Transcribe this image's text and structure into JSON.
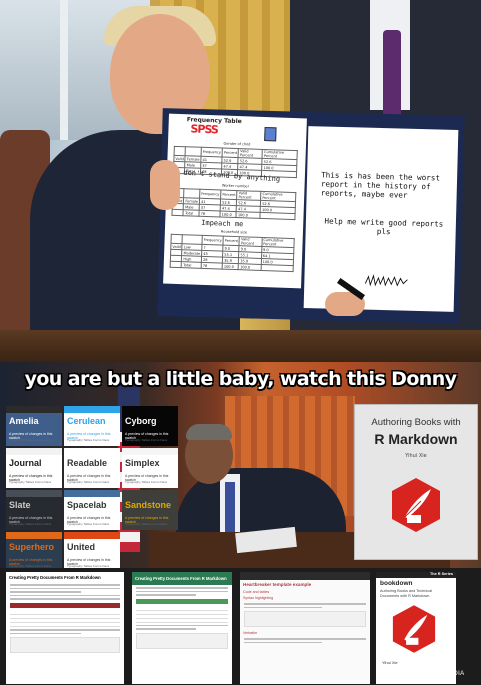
{
  "top_panel": {
    "folder_left": {
      "table_title": "Frequency Table",
      "logo": "SPSS",
      "first_table_caption": "Gender of child",
      "handwritten_line_1": "I don't stand by anything",
      "second_table_caption": "Worker number",
      "handwritten_line_2": "Impeach me",
      "third_table_caption": "Household size",
      "table_rows": [
        [
          "",
          "",
          "Frequency",
          "Percent",
          "Valid Percent",
          "Cumulative Percent"
        ],
        [
          "Valid",
          "Female",
          "41",
          "52.6",
          "52.6",
          "52.6"
        ],
        [
          "",
          "Male",
          "37",
          "47.4",
          "47.4",
          "100.0"
        ],
        [
          "",
          "Total",
          "78",
          "100.0",
          "100.0",
          ""
        ]
      ],
      "third_table_rows": [
        [
          "",
          "",
          "Frequency",
          "Percent",
          "Valid Percent",
          "Cumulative Percent"
        ],
        [
          "Valid",
          "Low",
          "7",
          "9.0",
          "9.0",
          "9.0"
        ],
        [
          "",
          "Moderate",
          "43",
          "55.1",
          "55.1",
          "64.1"
        ],
        [
          "",
          "High",
          "28",
          "35.9",
          "35.9",
          "100.0"
        ],
        [
          "",
          "Total",
          "78",
          "100.0",
          "100.0",
          ""
        ]
      ]
    },
    "folder_right": {
      "note_1": "This is has been the worst report in the history of reports, maybe ever",
      "note_2": "Help me write good reports pls"
    }
  },
  "middle_panel": {
    "caption": "you are but a little baby, watch this Donny",
    "themes": [
      {
        "name": "Amelia",
        "bar": "#2b2b2b",
        "bg": "#3f5f8a",
        "fg": "#ffffff"
      },
      {
        "name": "Cerulean",
        "bar": "#2fa4e7",
        "bg": "#ffffff",
        "fg": "#2fa4e7"
      },
      {
        "name": "Cyborg",
        "bar": "#060606",
        "bg": "#060606",
        "fg": "#ffffff"
      },
      {
        "name": "Journal",
        "bar": "#f2f2f2",
        "bg": "#ffffff",
        "fg": "#222222"
      },
      {
        "name": "Readable",
        "bar": "#ffffff",
        "bg": "#ffffff",
        "fg": "#333333"
      },
      {
        "name": "Simplex",
        "bar": "#f5f5f5",
        "bg": "#ffffff",
        "fg": "#333333"
      },
      {
        "name": "Slate",
        "bar": "#484e55",
        "bg": "#272b30",
        "fg": "#c8c8c8"
      },
      {
        "name": "Spacelab",
        "bar": "#446e9b",
        "bg": "#ffffff",
        "fg": "#333333"
      },
      {
        "name": "Sandstone",
        "bar": "#3e3f3a",
        "bg": "#3e3f3a",
        "fg": "#e0a800"
      },
      {
        "name": "Superhero",
        "bar": "#df691a",
        "bg": "#2b3e50",
        "fg": "#df691a"
      },
      {
        "name": "United",
        "bar": "#dd4814",
        "bg": "#ffffff",
        "fg": "#333333"
      }
    ],
    "theme_subtitle": "A preview of changes in this swatch",
    "theme_links": "Typography Tables Forms Navs",
    "book": {
      "title_line_1": "Authoring Books with",
      "title_line_2": "R Markdown",
      "author": "Yihui Xie",
      "hex_color": "#d8241f"
    }
  },
  "bottom_panel": {
    "doc_1_title": "Creating Pretty Documents From R Markdown",
    "doc_2_title": "Creating Pretty Documents From R Markdown",
    "doc_3_title": "Heartbreaker template example",
    "doc_3_section_1": "Code and tables",
    "doc_3_section_2": "Syntax highlighting",
    "doc_3_section_3": "Verbatim",
    "book": {
      "series": "The R Series",
      "title": "bookdown",
      "subtitle": "Authoring Books and Technical Documents with R Markdown",
      "author": "Yihui Xie"
    },
    "watermark": "REUTERS MEDIA EXPRESS"
  }
}
